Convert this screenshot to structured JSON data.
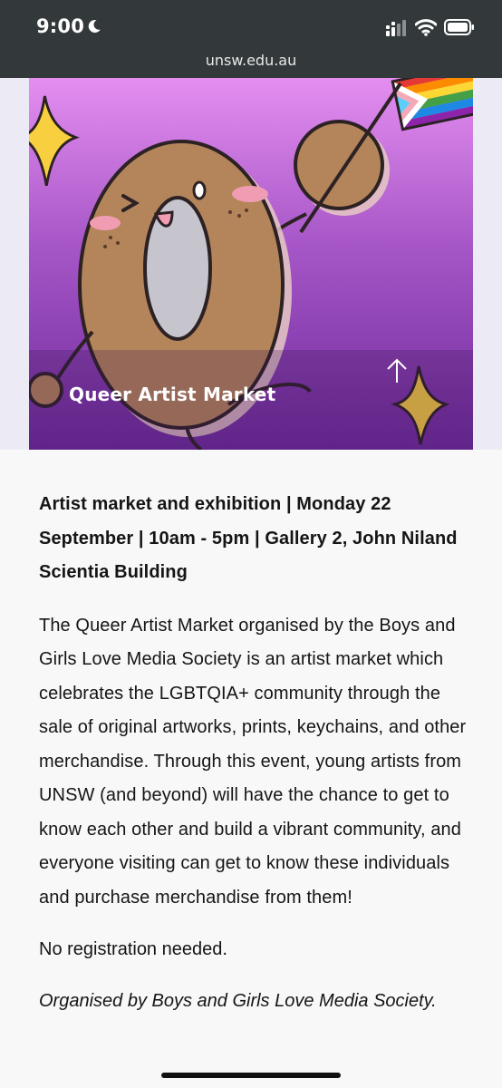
{
  "status_bar": {
    "time": "9:00",
    "icons": [
      "moon-icon",
      "cellular-signal-icon",
      "wifi-icon",
      "battery-icon"
    ]
  },
  "browser": {
    "url": "unsw.edu.au"
  },
  "hero": {
    "title": "Queer Artist Market",
    "icon": "arrow-up-icon",
    "colors": {
      "background_top": "#e48ef0",
      "background_bottom": "#6d2a9a",
      "band": "#ecebf5"
    }
  },
  "article": {
    "event_details": "Artist market and exhibition | Monday 22 September | 10am - 5pm | Gallery 2, John Niland Scientia Building",
    "description": "The Queer Artist Market organised by the Boys and Girls Love Media Society is an artist market which celebrates the LGBTQIA+ community through the sale of original artworks, prints, keychains, and other merchandise. Through this event, young artists from UNSW (and beyond) will have the chance to get to know each other and build a vibrant community, and everyone visiting can get to know these individuals and purchase merchandise from them!",
    "registration": "No registration needed.",
    "organiser": "Organised by Boys and Girls Love Media Society."
  }
}
